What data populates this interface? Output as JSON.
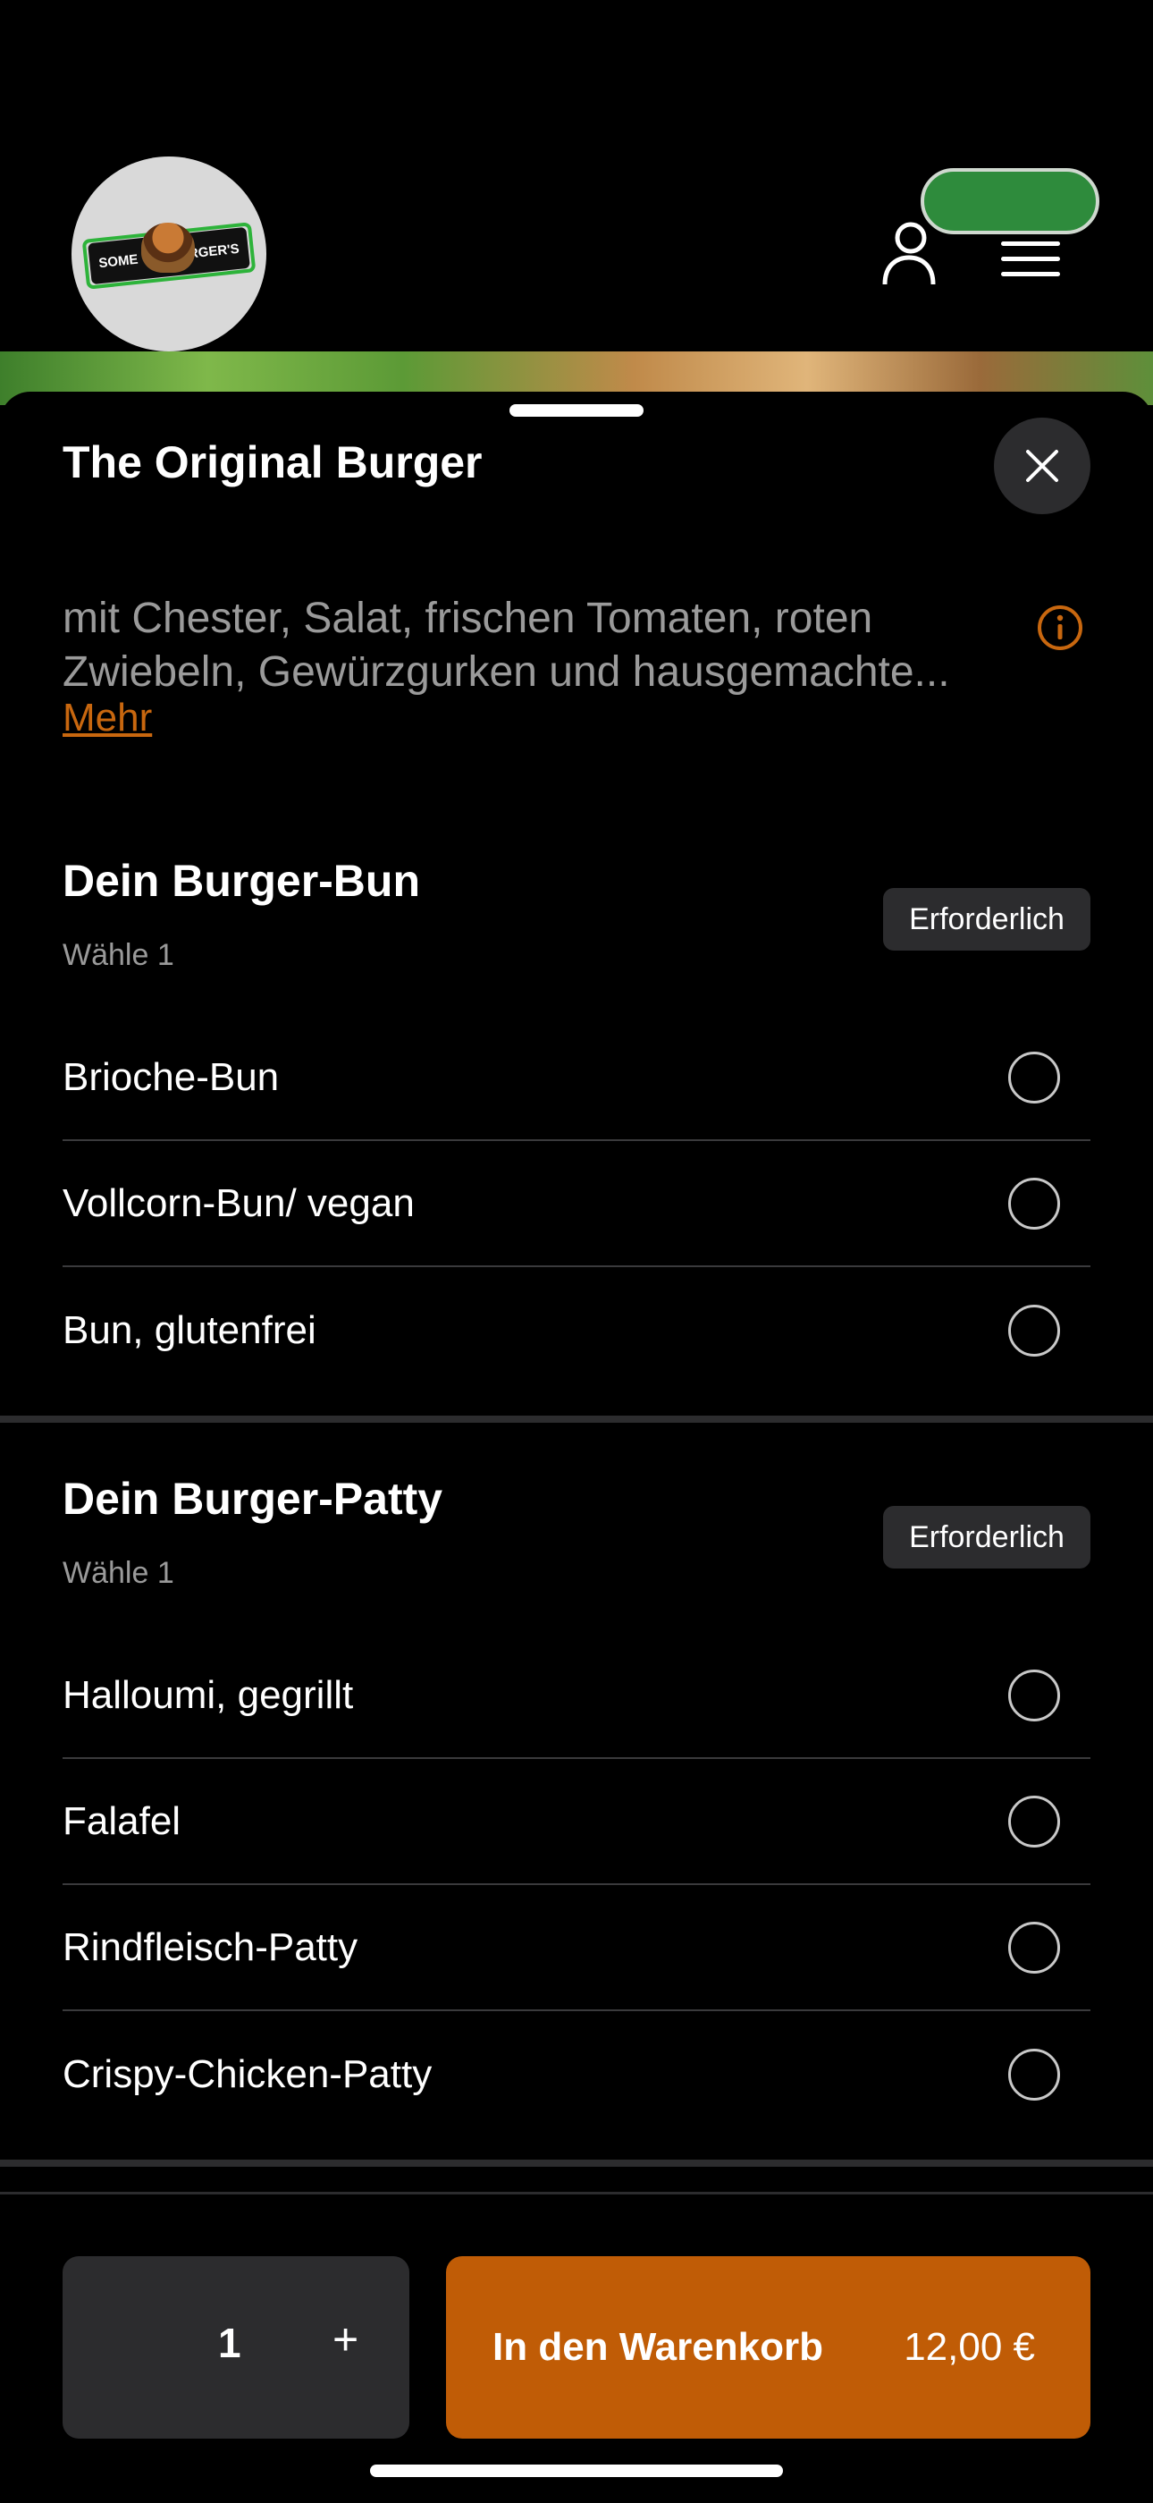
{
  "header": {
    "logo_text_left": "SOME",
    "logo_text_right": "BURGER'S",
    "accent_green": "#2e8b3c",
    "icons": [
      "user-icon",
      "menu-icon"
    ]
  },
  "product": {
    "title": "The Original Burger",
    "description": "mit Chester, Salat, frischen Tomaten, roten Zwiebeln, Gewürzgurken und hausgemachte...",
    "more_link": "Mehr"
  },
  "sections": [
    {
      "title": "Dein Burger-Bun",
      "subtitle": "Wähle 1",
      "badge": "Erforderlich",
      "options": [
        "Brioche-Bun",
        "Vollcorn-Bun/ vegan",
        "Bun, glutenfrei"
      ]
    },
    {
      "title": "Dein Burger-Patty",
      "subtitle": "Wähle 1",
      "badge": "Erforderlich",
      "options": [
        "Halloumi, gegrillt",
        "Falafel",
        "Rindfleisch-Patty",
        "Crispy-Chicken-Patty"
      ]
    }
  ],
  "cart": {
    "quantity": "1",
    "plus": "+",
    "add_label": "In den Warenkorb",
    "price": "12,00 €",
    "accent_orange": "#c05c06"
  }
}
